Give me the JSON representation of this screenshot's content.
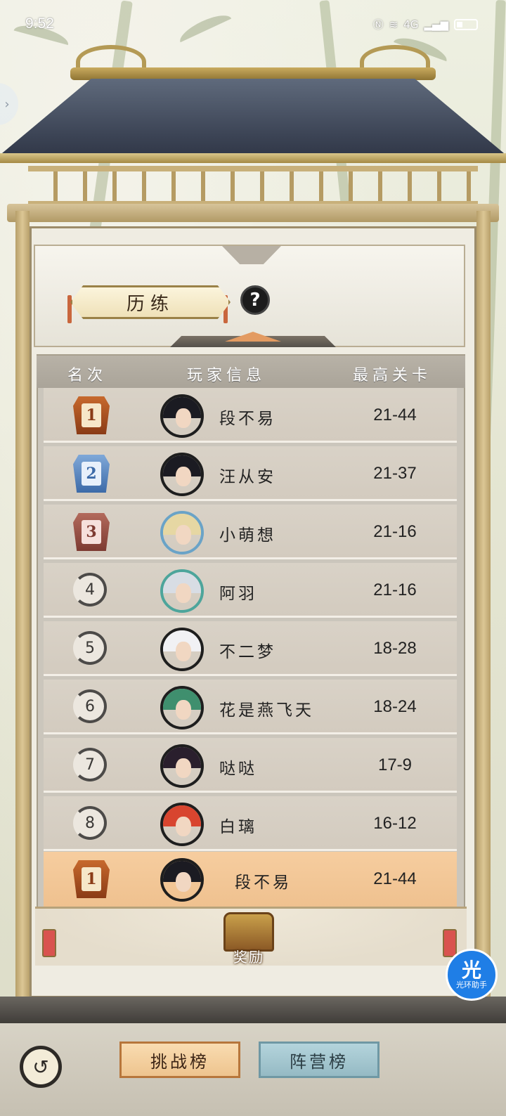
{
  "status_bar": {
    "time": "9:52",
    "signal_label": "4G",
    "icons": [
      "nfc-icon",
      "wifi-icon",
      "signal-icon",
      "battery-icon"
    ]
  },
  "header": {
    "title": "历练",
    "help_symbol": "?"
  },
  "table": {
    "columns": [
      "名次",
      "玩家信息",
      "最高关卡"
    ],
    "rows": [
      {
        "rank": "1",
        "badge": "gold",
        "name": "段不易",
        "stage": "21-44"
      },
      {
        "rank": "2",
        "badge": "silver",
        "name": "汪从安",
        "stage": "21-37"
      },
      {
        "rank": "3",
        "badge": "bronze",
        "name": "小萌想",
        "stage": "21-16"
      },
      {
        "rank": "4",
        "badge": "circle",
        "name": "阿羽",
        "stage": "21-16"
      },
      {
        "rank": "5",
        "badge": "circle",
        "name": "不二梦",
        "stage": "18-28"
      },
      {
        "rank": "6",
        "badge": "circle",
        "name": "花是燕飞天",
        "stage": "18-24"
      },
      {
        "rank": "7",
        "badge": "circle",
        "name": "哒哒",
        "stage": "17-9"
      },
      {
        "rank": "8",
        "badge": "circle",
        "name": "白璃",
        "stage": "16-12"
      }
    ],
    "my_row": {
      "rank": "1",
      "name": "段不易",
      "stage": "21-44"
    }
  },
  "reward": {
    "label": "奖励"
  },
  "tabs": {
    "challenge": "挑战榜",
    "camp": "阵营榜"
  },
  "assistant": {
    "badge": "光",
    "label": "光环助手"
  },
  "colors": {
    "gold_badge": "#c7692d",
    "silver_badge": "#3c6aa8",
    "bronze_badge": "#7d3a31",
    "highlight_row": "#f6cd9f",
    "active_tab": "#f9dcb1",
    "inactive_tab": "#b4d4dc",
    "assistant_blue": "#1f7ee6"
  }
}
